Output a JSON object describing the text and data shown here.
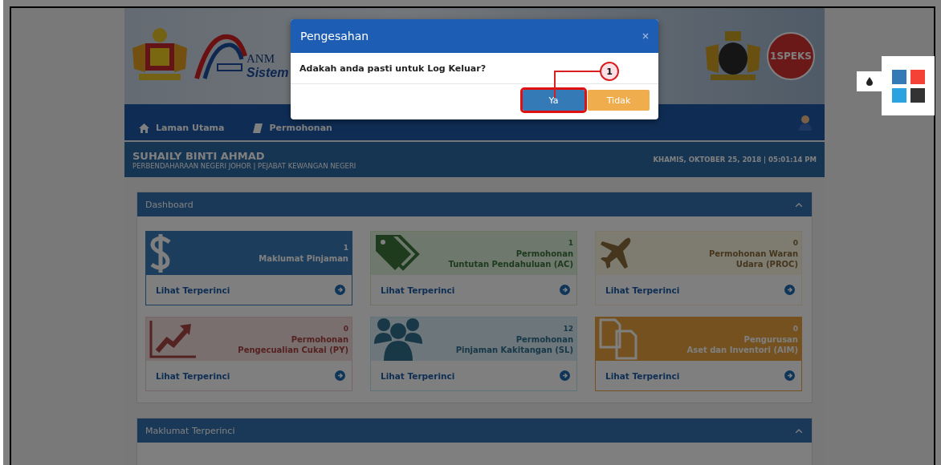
{
  "header": {
    "brand": "ANM",
    "brand_subtitle": "Sistem",
    "logo_text": "1SPEKS"
  },
  "nav": {
    "items": [
      {
        "label": "Laman Utama"
      },
      {
        "label": "Permohonan"
      }
    ]
  },
  "user_bar": {
    "name": "SUHAILY BINTI AHMAD",
    "organization": "PERBENDAHARAAN NEGERI JOHOR | PEJABAT KEWANGAN NEGERI",
    "datetime": "KHAMIS, OKTOBER 25, 2018 | 05:01:14 PM"
  },
  "dashboard": {
    "title": "Dashboard",
    "cards": [
      {
        "count": "1",
        "title_lines": [
          "Maklumat Pinjaman"
        ],
        "link": "Lihat Terperinci",
        "kind": "primary"
      },
      {
        "count": "1",
        "title_lines": [
          "Permohonan",
          "Tuntutan Pendahuluan (AC)"
        ],
        "link": "Lihat Terperinci",
        "kind": "success"
      },
      {
        "count": "0",
        "title_lines": [
          "Permohonan Waran",
          "Udara (PROC)"
        ],
        "link": "Lihat Terperinci",
        "kind": "notice"
      },
      {
        "count": "0",
        "title_lines": [
          "Permohonan",
          "Pengecualian Cukai (PY)"
        ],
        "link": "Lihat Terperinci",
        "kind": "danger"
      },
      {
        "count": "12",
        "title_lines": [
          "Permohonan",
          "Pinjaman Kakitangan (SL)"
        ],
        "link": "Lihat Terperinci",
        "kind": "info"
      },
      {
        "count": "0",
        "title_lines": [
          "Pengurusan",
          "Aset dan Inventori (AIM)"
        ],
        "link": "Lihat Terperinci",
        "kind": "warning"
      }
    ]
  },
  "details_panel": {
    "title": "Maklumat Terperinci"
  },
  "modal": {
    "title": "Pengesahan",
    "message": "Adakah anda pasti untuk Log Keluar?",
    "buttons": [
      {
        "label": "Ya",
        "kind": "primary",
        "highlighted": true
      },
      {
        "label": "Tidak",
        "kind": "warning",
        "highlighted": false
      }
    ]
  },
  "callout": {
    "number": "1"
  },
  "theme_palette": {
    "swatches": [
      {
        "color": "#337ab7"
      },
      {
        "color": "#f44336"
      },
      {
        "color": "#2ba3e0"
      },
      {
        "color": "#333333"
      }
    ]
  }
}
